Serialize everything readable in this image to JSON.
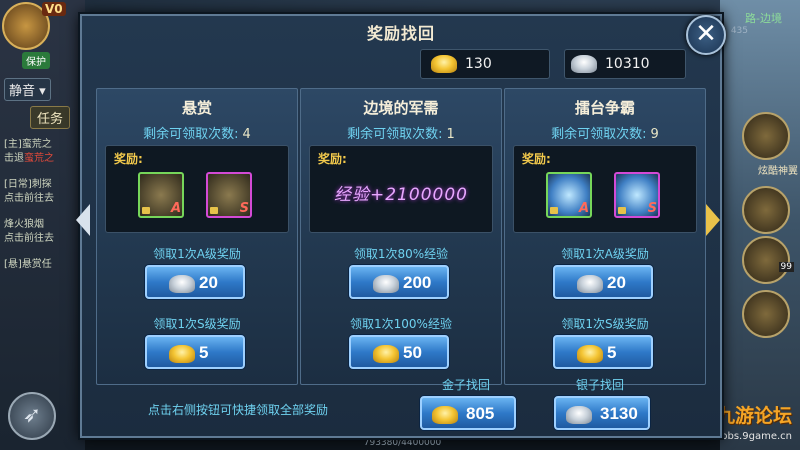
{
  "modal": {
    "title": "奖励找回",
    "close_icon": "close-icon",
    "gold_balance": "130",
    "silver_balance": "10310",
    "footer_hint": "点击右侧按钮可快捷领取全部奖励",
    "gold_bulk": {
      "label": "金子找回",
      "value": "805"
    },
    "silver_bulk": {
      "label": "银子找回",
      "value": "3130"
    }
  },
  "panels": [
    {
      "title": "悬赏",
      "count_label": "剩余可领取次数:",
      "count": "4",
      "reward_label": "奖励:",
      "items": [
        {
          "icon": "green-money-bag-icon",
          "grade": "A"
        },
        {
          "icon": "purple-money-bag-icon",
          "grade": "S"
        }
      ],
      "claim1_label": "领取1次A级奖励",
      "claim1_cost": "20",
      "claim2_label": "领取1次S级奖励",
      "claim2_cost": "5"
    },
    {
      "title": "边境的军需",
      "count_label": "剩余可领取次数:",
      "count": "1",
      "reward_label": "奖励:",
      "exp_text": "经验+2100000",
      "claim1_label": "领取1次80%经验",
      "claim1_cost": "200",
      "claim2_label": "领取1次100%经验",
      "claim2_cost": "50"
    },
    {
      "title": "擂台争霸",
      "count_label": "剩余可领取次数:",
      "count": "9",
      "reward_label": "奖励:",
      "items": [
        {
          "icon": "treasure-chest-icon",
          "grade": "A"
        },
        {
          "icon": "treasure-chest-icon",
          "grade": "S"
        }
      ],
      "claim1_label": "领取1次A级奖励",
      "claim1_cost": "20",
      "claim2_label": "领取1次S级奖励",
      "claim2_cost": "5"
    }
  ],
  "hud": {
    "vip": "V0",
    "protect": "保护",
    "mute": "静音",
    "task_tab": "任务",
    "quests": [
      {
        "tag": "[主]",
        "name": "蛮荒之",
        "action": "击退",
        "target": "蛮荒之"
      },
      {
        "tag": "[日常]",
        "name": "刺探",
        "action": "点击前往去",
        "target": ""
      },
      {
        "tag": "",
        "name": "烽火狼烟",
        "action": "点击前往去",
        "target": ""
      },
      {
        "tag": "[悬]",
        "name": "悬赏任",
        "action": "",
        "target": ""
      }
    ],
    "map_name": "路-边境",
    "map_coord": "435",
    "right_label": "炫酷神翼",
    "right_count": "99",
    "exp_progress": "793380/4400000"
  },
  "watermark": {
    "main": "九游论坛",
    "sub": "bbs.9game.cn"
  }
}
